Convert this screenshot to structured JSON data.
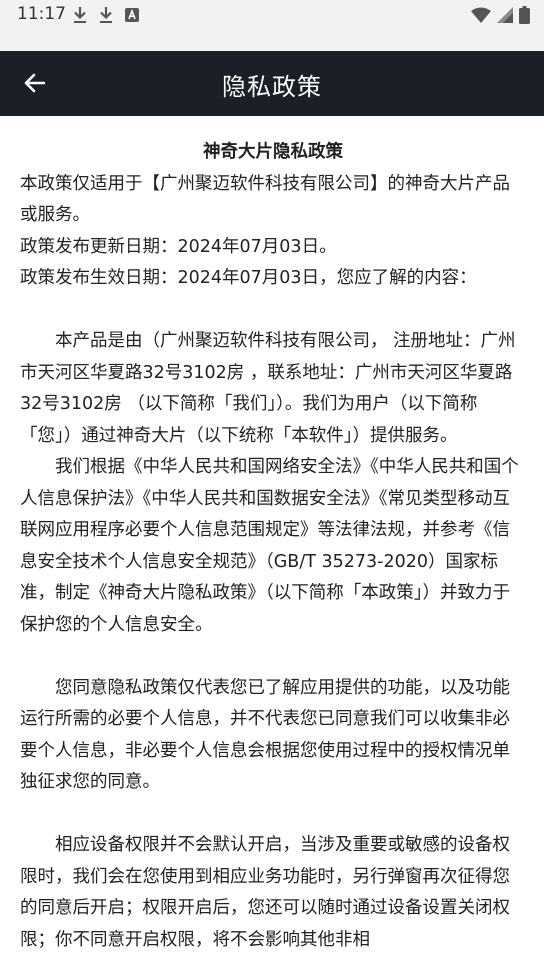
{
  "status_bar": {
    "time": "11:17",
    "left_icons": [
      "download-icon",
      "download-icon",
      "text-a-icon"
    ],
    "right_icons": [
      "wifi-icon",
      "signal-icon",
      "battery-icon"
    ]
  },
  "app_bar": {
    "title": "隐私政策",
    "back_icon": "arrow-left-icon",
    "background": "#1b1f27"
  },
  "document": {
    "title": "神奇大片隐私政策",
    "intro": [
      "本政策仅适用于【广州聚迈软件科技有限公司】的神奇大片产品或服务。",
      "政策发布更新日期：2024年07月03日。",
      "政策发布生效日期：2024年07月03日，您应了解的内容："
    ],
    "paragraphs": [
      "本产品是由（广州聚迈软件科技有限公司， 注册地址：广州市天河区华夏路32号3102房 ，联系地址：广州市天河区华夏路32号3102房 （以下简称「我们」）。我们为用户（以下简称「您」）通过神奇大片（以下统称「本软件」）提供服务。",
      "我们根据《中华人民共和国网络安全法》《中华人民共和国个人信息保护法》《中华人民共和国数据安全法》《常见类型移动互联网应用程序必要个人信息范围规定》等法律法规，并参考《信息安全技术个人信息安全规范》（GB/T 35273-2020）国家标准，制定《神奇大片隐私政策》（以下简称「本政策」）并致力于保护您的个人信息安全。",
      "您同意隐私政策仅代表您已了解应用提供的功能，以及功能运行所需的必要个人信息，并不代表您已同意我们可以收集非必要个人信息，非必要个人信息会根据您使用过程中的授权情况单独征求您的同意。",
      "相应设备权限并不会默认开启，当涉及重要或敏感的设备权限时，我们会在您使用到相应业务功能时，另行弹窗再次征得您的同意后开启；权限开启后，您还可以随时通过设备设置关闭权限；你不同意开启权限，将不会影响其他非相"
    ]
  }
}
